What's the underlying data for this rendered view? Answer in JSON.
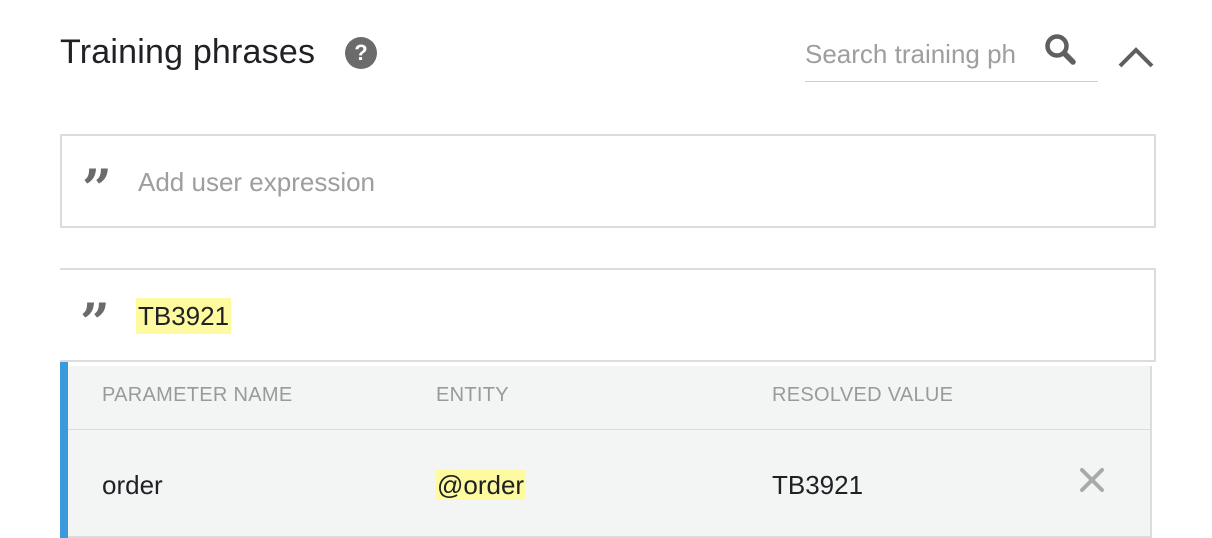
{
  "header": {
    "title": "Training phrases",
    "help_icon": "help-circle-icon",
    "search": {
      "placeholder": "Search training ph",
      "value": ""
    },
    "search_icon": "search-icon",
    "collapse_icon": "chevron-up-icon"
  },
  "add_expression": {
    "icon": "quote-icon",
    "placeholder": "Add user expression",
    "value": ""
  },
  "phrase": {
    "text": "TB3921",
    "accent_color": "#3b9ad9",
    "highlight_color": "#fdfaa0",
    "parameters": {
      "headers": [
        "PARAMETER NAME",
        "ENTITY",
        "RESOLVED VALUE"
      ],
      "rows": [
        {
          "name": "order",
          "entity": "@order",
          "resolved_value": "TB3921",
          "remove_icon": "close-icon"
        }
      ]
    }
  }
}
